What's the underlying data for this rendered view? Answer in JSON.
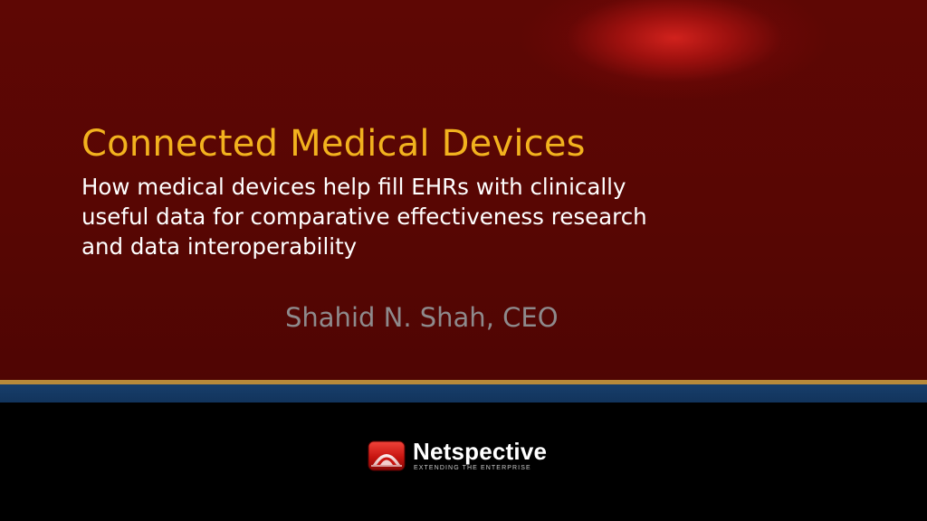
{
  "slide": {
    "title": "Connected Medical Devices",
    "subtitle_lines": [
      "How medical devices help fill EHRs with clinically",
      "useful data for comparative effectiveness research",
      "and data interoperability"
    ],
    "presenter": "Shahid N. Shah, CEO"
  },
  "logo": {
    "name": "Netspective",
    "tagline": "EXTENDING THE ENTERPRISE",
    "icon": "netspective-logo-icon"
  },
  "colors": {
    "background_top": "#5e0704",
    "title": "#f2b21e",
    "subtitle": "#ffffff",
    "presenter": "#8e8a8c",
    "stripe_gold": "#b88a3a",
    "stripe_blue": "#173e6b",
    "background_bottom": "#000000"
  }
}
